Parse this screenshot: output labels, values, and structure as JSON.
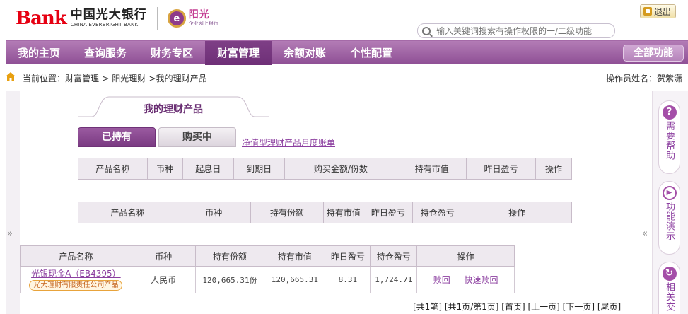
{
  "header": {
    "logo_mark": "Bank",
    "logo_cn": "中国光大银行",
    "logo_en": "CHINA EVERBRIGHT BANK",
    "badge_title": "阳光",
    "badge_sub": "企业网上银行",
    "exit_label": "退出",
    "search_placeholder": "输入关键词搜索有操作权限的一/二级功能"
  },
  "nav": {
    "items": [
      {
        "label": "我的主页"
      },
      {
        "label": "查询服务"
      },
      {
        "label": "财务专区"
      },
      {
        "label": "财富管理"
      },
      {
        "label": "余额对账"
      },
      {
        "label": "个性配置"
      }
    ],
    "active_index": 3,
    "all_functions": "全部功能"
  },
  "breadcrumb": {
    "text": "当前位置：财富管理->   阳光理财->我的理财产品",
    "operator": "操作员姓名：贺紫潇"
  },
  "page": {
    "title": "我的理财产品",
    "tabs": [
      "已持有",
      "购买中"
    ],
    "active_tab": 0,
    "link": "净值型理财产品月度账单"
  },
  "table1": {
    "headers": [
      "产品名称",
      "币种",
      "起息日",
      "到期日",
      "购买金额/份数",
      "持有市值",
      "昨日盈亏",
      "操作"
    ]
  },
  "table2": {
    "headers": [
      "产品名称",
      "币种",
      "持有份额",
      "持有市值",
      "昨日盈亏",
      "持仓盈亏",
      "操作"
    ]
  },
  "table3": {
    "headers": [
      "产品名称",
      "币种",
      "持有份额",
      "持有市值",
      "昨日盈亏",
      "持仓盈亏",
      "操作"
    ],
    "rows": [
      {
        "name": "光银现金A（EB4395）",
        "issuer": "光大理财有限责任公司产品",
        "currency": "人民币",
        "shares": "120,665.31份",
        "market_value": "120,665.31",
        "yesterday_pl": "8.31",
        "position_pl": "1,724.71",
        "ops": [
          "赎回",
          "快速赎回"
        ]
      }
    ]
  },
  "pager": "[共1笔]  [共1页/第1页]  [首页]  [上一页]  [下一页]  [尾页]",
  "sidebar": {
    "items": [
      {
        "label": "需要帮助",
        "icon": "?"
      },
      {
        "label": "功能演示",
        "icon": "▶"
      },
      {
        "label": "相关交",
        "icon": "↻"
      }
    ]
  },
  "colors": {
    "brand_purple": "#8e4f95",
    "brand_red": "#e60012",
    "link_purple": "#8c3fa0"
  }
}
